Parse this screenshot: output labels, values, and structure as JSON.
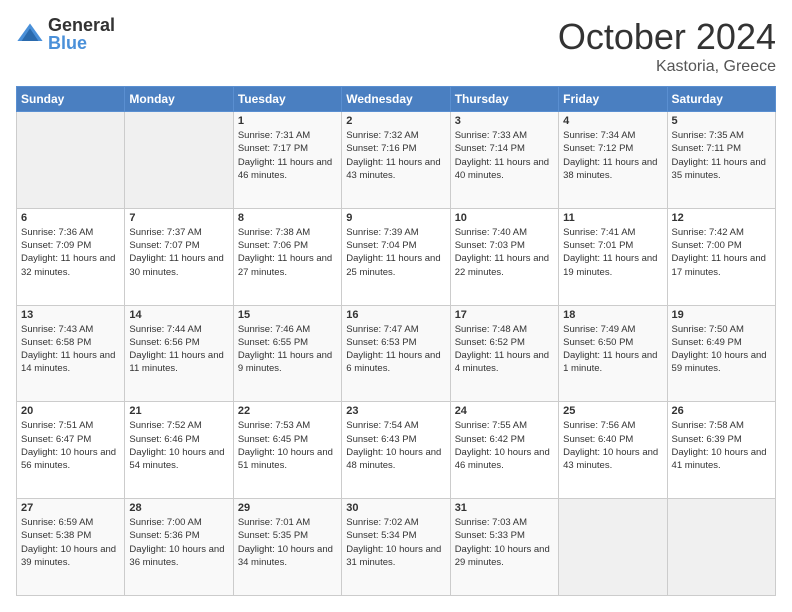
{
  "logo": {
    "general": "General",
    "blue": "Blue"
  },
  "header": {
    "month": "October 2024",
    "location": "Kastoria, Greece"
  },
  "weekdays": [
    "Sunday",
    "Monday",
    "Tuesday",
    "Wednesday",
    "Thursday",
    "Friday",
    "Saturday"
  ],
  "weeks": [
    [
      {
        "day": "",
        "sunrise": "",
        "sunset": "",
        "daylight": "",
        "empty": true
      },
      {
        "day": "",
        "sunrise": "",
        "sunset": "",
        "daylight": "",
        "empty": true
      },
      {
        "day": "1",
        "sunrise": "Sunrise: 7:31 AM",
        "sunset": "Sunset: 7:17 PM",
        "daylight": "Daylight: 11 hours and 46 minutes."
      },
      {
        "day": "2",
        "sunrise": "Sunrise: 7:32 AM",
        "sunset": "Sunset: 7:16 PM",
        "daylight": "Daylight: 11 hours and 43 minutes."
      },
      {
        "day": "3",
        "sunrise": "Sunrise: 7:33 AM",
        "sunset": "Sunset: 7:14 PM",
        "daylight": "Daylight: 11 hours and 40 minutes."
      },
      {
        "day": "4",
        "sunrise": "Sunrise: 7:34 AM",
        "sunset": "Sunset: 7:12 PM",
        "daylight": "Daylight: 11 hours and 38 minutes."
      },
      {
        "day": "5",
        "sunrise": "Sunrise: 7:35 AM",
        "sunset": "Sunset: 7:11 PM",
        "daylight": "Daylight: 11 hours and 35 minutes."
      }
    ],
    [
      {
        "day": "6",
        "sunrise": "Sunrise: 7:36 AM",
        "sunset": "Sunset: 7:09 PM",
        "daylight": "Daylight: 11 hours and 32 minutes."
      },
      {
        "day": "7",
        "sunrise": "Sunrise: 7:37 AM",
        "sunset": "Sunset: 7:07 PM",
        "daylight": "Daylight: 11 hours and 30 minutes."
      },
      {
        "day": "8",
        "sunrise": "Sunrise: 7:38 AM",
        "sunset": "Sunset: 7:06 PM",
        "daylight": "Daylight: 11 hours and 27 minutes."
      },
      {
        "day": "9",
        "sunrise": "Sunrise: 7:39 AM",
        "sunset": "Sunset: 7:04 PM",
        "daylight": "Daylight: 11 hours and 25 minutes."
      },
      {
        "day": "10",
        "sunrise": "Sunrise: 7:40 AM",
        "sunset": "Sunset: 7:03 PM",
        "daylight": "Daylight: 11 hours and 22 minutes."
      },
      {
        "day": "11",
        "sunrise": "Sunrise: 7:41 AM",
        "sunset": "Sunset: 7:01 PM",
        "daylight": "Daylight: 11 hours and 19 minutes."
      },
      {
        "day": "12",
        "sunrise": "Sunrise: 7:42 AM",
        "sunset": "Sunset: 7:00 PM",
        "daylight": "Daylight: 11 hours and 17 minutes."
      }
    ],
    [
      {
        "day": "13",
        "sunrise": "Sunrise: 7:43 AM",
        "sunset": "Sunset: 6:58 PM",
        "daylight": "Daylight: 11 hours and 14 minutes."
      },
      {
        "day": "14",
        "sunrise": "Sunrise: 7:44 AM",
        "sunset": "Sunset: 6:56 PM",
        "daylight": "Daylight: 11 hours and 11 minutes."
      },
      {
        "day": "15",
        "sunrise": "Sunrise: 7:46 AM",
        "sunset": "Sunset: 6:55 PM",
        "daylight": "Daylight: 11 hours and 9 minutes."
      },
      {
        "day": "16",
        "sunrise": "Sunrise: 7:47 AM",
        "sunset": "Sunset: 6:53 PM",
        "daylight": "Daylight: 11 hours and 6 minutes."
      },
      {
        "day": "17",
        "sunrise": "Sunrise: 7:48 AM",
        "sunset": "Sunset: 6:52 PM",
        "daylight": "Daylight: 11 hours and 4 minutes."
      },
      {
        "day": "18",
        "sunrise": "Sunrise: 7:49 AM",
        "sunset": "Sunset: 6:50 PM",
        "daylight": "Daylight: 11 hours and 1 minute."
      },
      {
        "day": "19",
        "sunrise": "Sunrise: 7:50 AM",
        "sunset": "Sunset: 6:49 PM",
        "daylight": "Daylight: 10 hours and 59 minutes."
      }
    ],
    [
      {
        "day": "20",
        "sunrise": "Sunrise: 7:51 AM",
        "sunset": "Sunset: 6:47 PM",
        "daylight": "Daylight: 10 hours and 56 minutes."
      },
      {
        "day": "21",
        "sunrise": "Sunrise: 7:52 AM",
        "sunset": "Sunset: 6:46 PM",
        "daylight": "Daylight: 10 hours and 54 minutes."
      },
      {
        "day": "22",
        "sunrise": "Sunrise: 7:53 AM",
        "sunset": "Sunset: 6:45 PM",
        "daylight": "Daylight: 10 hours and 51 minutes."
      },
      {
        "day": "23",
        "sunrise": "Sunrise: 7:54 AM",
        "sunset": "Sunset: 6:43 PM",
        "daylight": "Daylight: 10 hours and 48 minutes."
      },
      {
        "day": "24",
        "sunrise": "Sunrise: 7:55 AM",
        "sunset": "Sunset: 6:42 PM",
        "daylight": "Daylight: 10 hours and 46 minutes."
      },
      {
        "day": "25",
        "sunrise": "Sunrise: 7:56 AM",
        "sunset": "Sunset: 6:40 PM",
        "daylight": "Daylight: 10 hours and 43 minutes."
      },
      {
        "day": "26",
        "sunrise": "Sunrise: 7:58 AM",
        "sunset": "Sunset: 6:39 PM",
        "daylight": "Daylight: 10 hours and 41 minutes."
      }
    ],
    [
      {
        "day": "27",
        "sunrise": "Sunrise: 6:59 AM",
        "sunset": "Sunset: 5:38 PM",
        "daylight": "Daylight: 10 hours and 39 minutes."
      },
      {
        "day": "28",
        "sunrise": "Sunrise: 7:00 AM",
        "sunset": "Sunset: 5:36 PM",
        "daylight": "Daylight: 10 hours and 36 minutes."
      },
      {
        "day": "29",
        "sunrise": "Sunrise: 7:01 AM",
        "sunset": "Sunset: 5:35 PM",
        "daylight": "Daylight: 10 hours and 34 minutes."
      },
      {
        "day": "30",
        "sunrise": "Sunrise: 7:02 AM",
        "sunset": "Sunset: 5:34 PM",
        "daylight": "Daylight: 10 hours and 31 minutes."
      },
      {
        "day": "31",
        "sunrise": "Sunrise: 7:03 AM",
        "sunset": "Sunset: 5:33 PM",
        "daylight": "Daylight: 10 hours and 29 minutes."
      },
      {
        "day": "",
        "sunrise": "",
        "sunset": "",
        "daylight": "",
        "empty": true
      },
      {
        "day": "",
        "sunrise": "",
        "sunset": "",
        "daylight": "",
        "empty": true
      }
    ]
  ]
}
